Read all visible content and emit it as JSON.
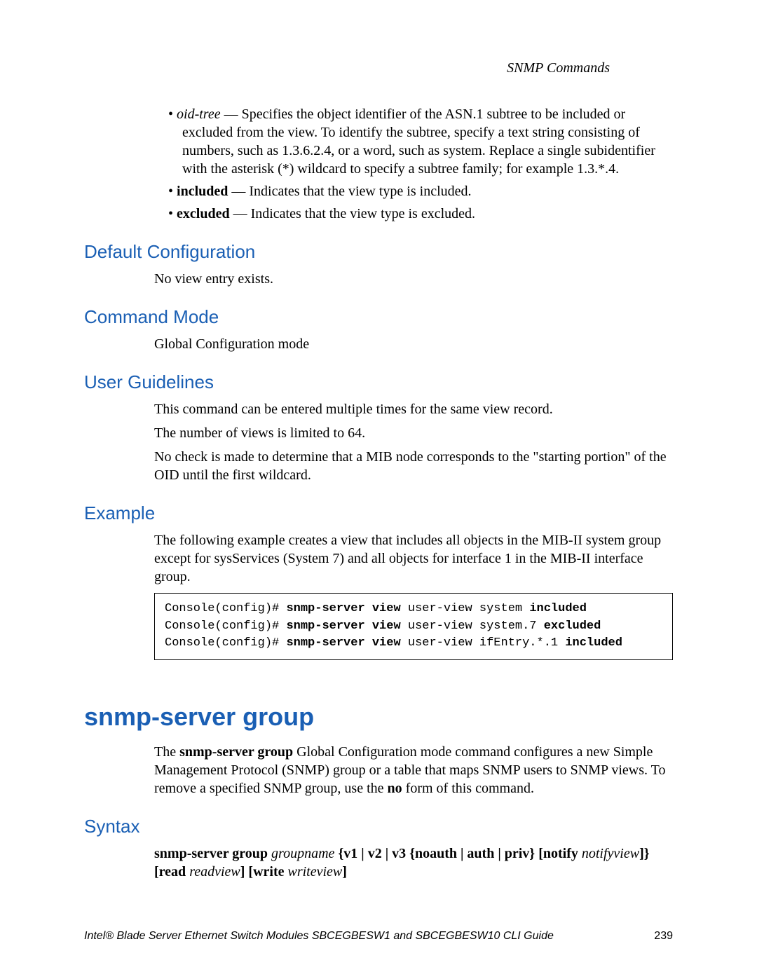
{
  "header": {
    "chapter": "SNMP Commands"
  },
  "bullets": [
    {
      "term": "oid-tree",
      "sep": " — ",
      "termStyle": "i",
      "text": "Specifies the object identifier of the ASN.1 subtree to be included or excluded from the view. To identify the subtree, specify a text string consisting of numbers, such as 1.3.6.2.4, or a word, such as system. Replace a single subidentifier with the asterisk (*) wildcard to specify a subtree family; for example 1.3.*.4."
    },
    {
      "term": "included",
      "sep": " — ",
      "termStyle": "b",
      "text": "Indicates that the view type is included."
    },
    {
      "term": "excluded",
      "sep": " — ",
      "termStyle": "b",
      "text": "Indicates that the view type is excluded."
    }
  ],
  "sections": {
    "defaultConfig": {
      "heading": "Default Configuration",
      "body1": "No view entry exists."
    },
    "commandMode": {
      "heading": "Command Mode",
      "body1": "Global Configuration mode"
    },
    "userGuidelines": {
      "heading": "User Guidelines",
      "body1": "This command can be entered multiple times for the same view record.",
      "body2": "The number of views is limited to 64.",
      "body3": "No check is made to determine that a MIB node corresponds to the \"starting portion\" of the OID until the first wildcard."
    },
    "example": {
      "heading": "Example",
      "body1": "The following example creates a view that includes all objects in the MIB-II system group except for sysServices (System 7) and all objects for interface 1 in the MIB-II interface group."
    }
  },
  "code": {
    "l1a": "Console(config)# ",
    "l1b": "snmp-server view",
    "l1c": " user-view system ",
    "l1d": "included",
    "l2a": "Console(config)# ",
    "l2b": "snmp-server view",
    "l2c": " user-view system.7 ",
    "l2d": "excluded",
    "l3a": "Console(config)# ",
    "l3b": "snmp-server view",
    "l3c": " user-view ifEntry.*.1 ",
    "l3d": "included"
  },
  "cmd": {
    "title": "snmp-server group",
    "intro": {
      "pre": "The ",
      "bold": "snmp-server group",
      "mid": " Global Configuration mode command configures a new Simple Management Protocol (SNMP) group or a table that maps SNMP users to SNMP views. To remove a specified SNMP group, use the ",
      "no": "no",
      "post": " form of this command."
    },
    "syntaxHeading": "Syntax",
    "syntax": {
      "p1": "snmp-server group",
      "p2": " groupname ",
      "p3": "{v1 | v2 | v3 {noauth | auth | priv}",
      "p4": " [notify",
      "p5": " notifyview",
      "p6": "]}",
      "p7": " [read",
      "p8": " readview",
      "p9": "] [write",
      "p10": " writeview",
      "p11": "]"
    }
  },
  "footer": {
    "left": "Intel® Blade Server Ethernet Switch Modules SBCEGBESW1 and SBCEGBESW10 CLI Guide",
    "right": "239"
  }
}
